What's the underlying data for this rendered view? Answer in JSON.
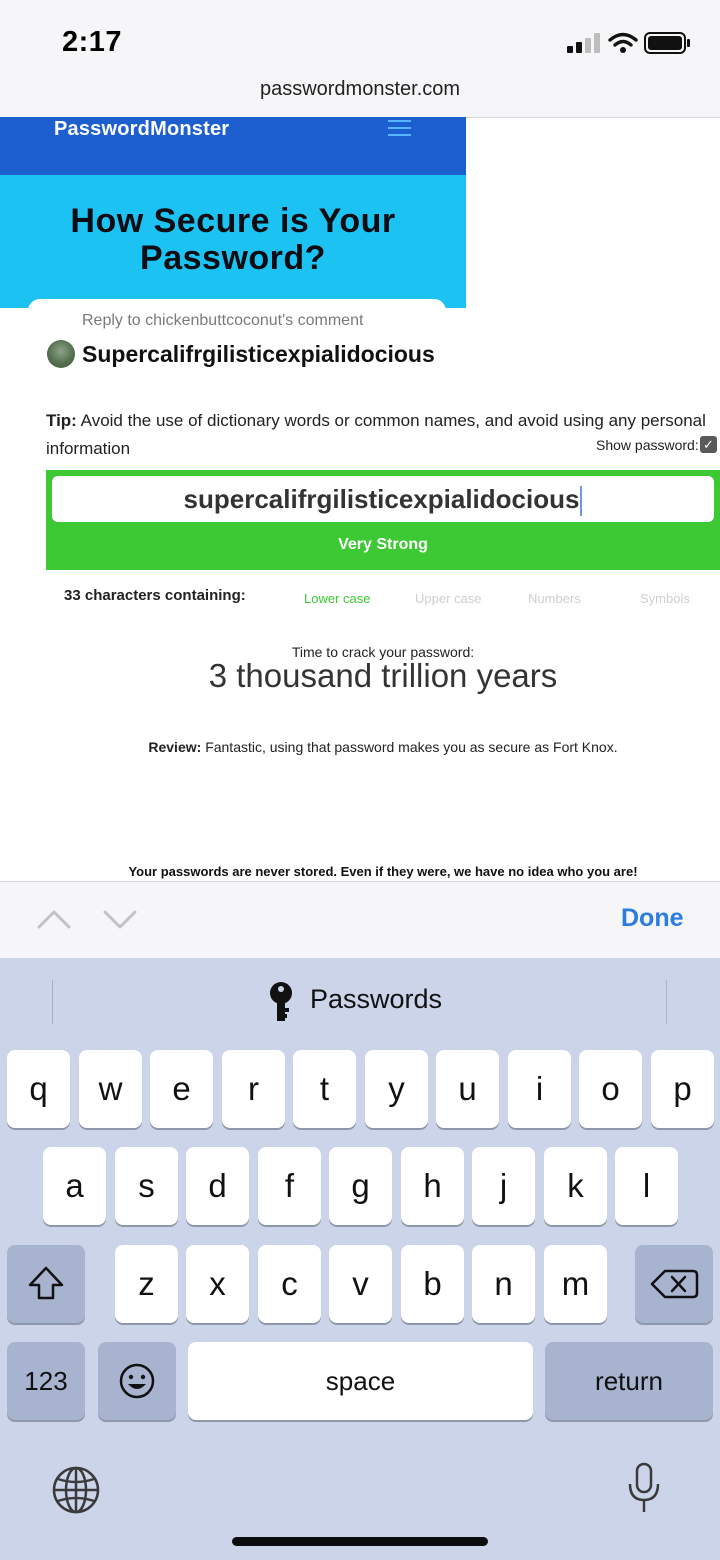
{
  "status": {
    "time": "2:17"
  },
  "browser": {
    "url": "passwordmonster.com"
  },
  "site": {
    "logo": "PasswordMonster",
    "hero_title": "How Secure is Your Password?"
  },
  "reply": {
    "label": "Reply to chickenbuttcoconut's comment",
    "text": "Supercalifrgilisticexpialidocious"
  },
  "tip": {
    "label": "Tip:",
    "text": "Avoid the use of dictionary words or common names, and avoid using any personal information",
    "show_password": "Show password:",
    "show_password_checked": true
  },
  "checker": {
    "password": "supercalifrgilisticexpialidocious",
    "strength": "Very Strong",
    "strength_color": "#3cc934",
    "characters_label": "33 characters containing:",
    "classes": [
      {
        "label": "Lower case",
        "active": true
      },
      {
        "label": "Upper case",
        "active": false
      },
      {
        "label": "Numbers",
        "active": false
      },
      {
        "label": "Symbols",
        "active": false
      }
    ],
    "crack_label": "Time to crack your password:",
    "crack_time": "3 thousand trillion years",
    "review_label": "Review:",
    "review_text": "Fantastic, using that password makes you as secure as Fort Knox.",
    "disclaimer": "Your passwords are never stored. Even if they were, we have no idea who you are!"
  },
  "accessory": {
    "done": "Done"
  },
  "keyboard": {
    "suggestion": "Passwords",
    "row1": [
      "q",
      "w",
      "e",
      "r",
      "t",
      "y",
      "u",
      "i",
      "o",
      "p"
    ],
    "row2": [
      "a",
      "s",
      "d",
      "f",
      "g",
      "h",
      "j",
      "k",
      "l"
    ],
    "row3": [
      "z",
      "x",
      "c",
      "v",
      "b",
      "n",
      "m"
    ],
    "numbers": "123",
    "space": "space",
    "return": "return"
  }
}
